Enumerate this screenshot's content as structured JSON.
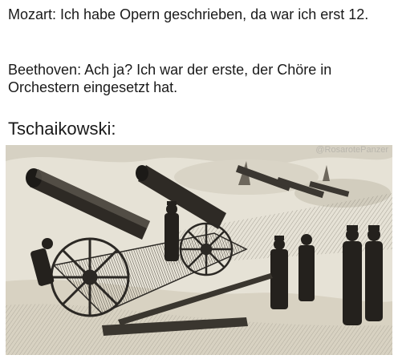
{
  "meme": {
    "mozart_line": "Mozart: Ich habe Opern geschrieben, da war ich erst 12.",
    "beethoven_line": "Beethoven: Ach ja? Ich war der erste, der Chöre in Orchestern eingesetzt hat.",
    "tchaikovsky_label": "Tschaikowski:"
  },
  "image": {
    "watermark": "@RosarotePanzer",
    "description_icon": "cannon-engraving-illustration"
  },
  "colors": {
    "text": "#1a1a1a",
    "paper": "#e6e2d6",
    "ink": "#2b2824"
  }
}
